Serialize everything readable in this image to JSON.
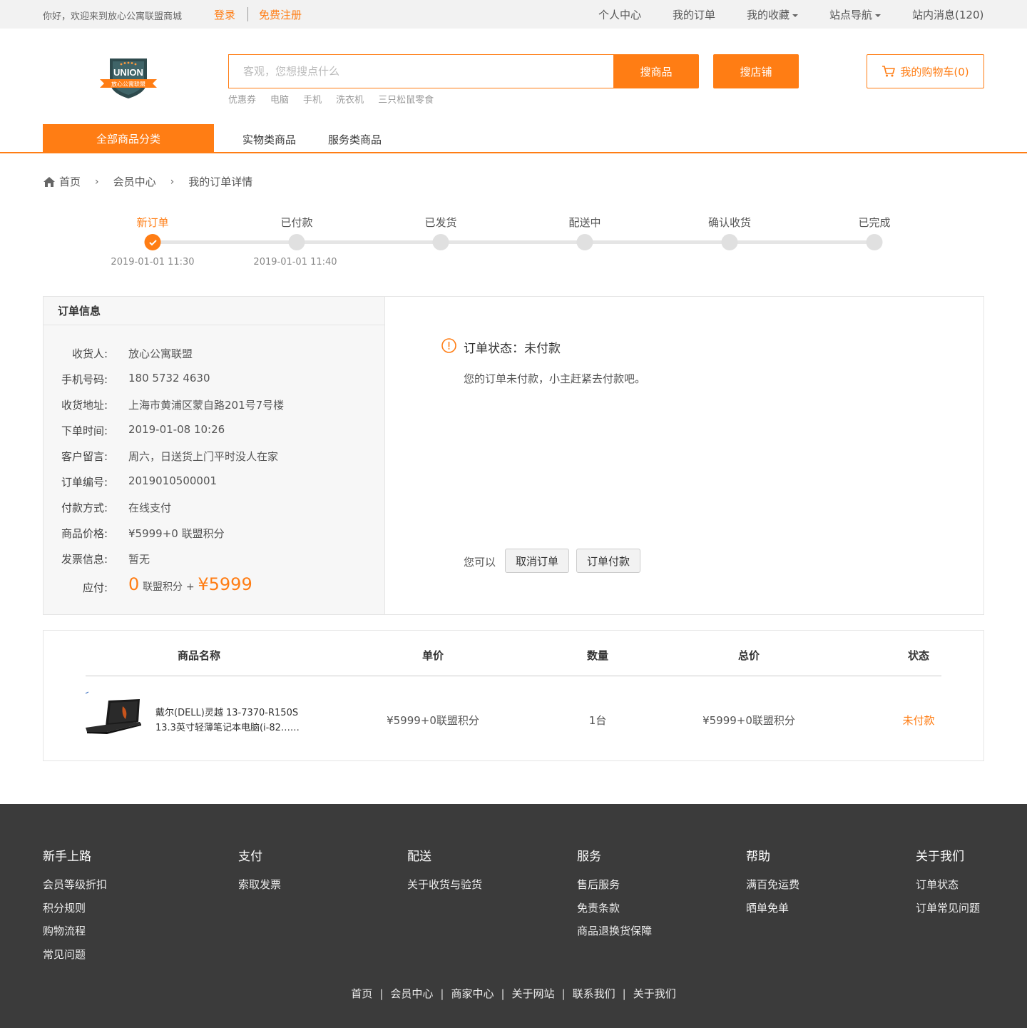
{
  "topbar": {
    "welcome": "你好，欢迎来到放心公寓联盟商城",
    "login": "登录",
    "register": "免费注册",
    "personal_center": "个人中心",
    "my_orders": "我的订单",
    "my_favorites": "我的收藏",
    "site_nav": "站点导航",
    "messages": "站内消息(120)"
  },
  "logo": {
    "text": "UNION",
    "subtext": "放心公寓联盟",
    "colors": {
      "shield": "#2e4a4d",
      "ribbon": "#ff7d14"
    }
  },
  "search": {
    "placeholder": "客观，您想搜点什么",
    "search_goods": "搜商品",
    "search_shops": "搜店铺",
    "hotwords": [
      "优惠券",
      "电脑",
      "手机",
      "洗衣机",
      "三只松鼠零食"
    ]
  },
  "cart": {
    "label": "我的购物车(0)"
  },
  "categories": {
    "all": "全部商品分类",
    "physical": "实物类商品",
    "service": "服务类商品"
  },
  "breadcrumb": {
    "home": "首页",
    "member": "会员中心",
    "current": "我的订单详情"
  },
  "progress": {
    "steps": [
      {
        "label": "新订单",
        "time": "2019-01-01  11:30",
        "active": true
      },
      {
        "label": "已付款",
        "time": "2019-01-01  11:40",
        "active": false
      },
      {
        "label": "已发货",
        "time": "",
        "active": false
      },
      {
        "label": "配送中",
        "time": "",
        "active": false
      },
      {
        "label": "确认收货",
        "time": "",
        "active": false
      },
      {
        "label": "已完成",
        "time": "",
        "active": false
      }
    ]
  },
  "order_info": {
    "title": "订单信息",
    "rows": [
      {
        "k": "收货人:",
        "v": "放心公寓联盟"
      },
      {
        "k": "手机号码:",
        "v": "180 5732 4630"
      },
      {
        "k": "收货地址:",
        "v": "上海市黄浦区蒙自路201号7号楼"
      },
      {
        "k": "下单时间:",
        "v": "2019-01-08 10:26"
      },
      {
        "k": "客户留言:",
        "v": "周六，日送货上门平时没人在家"
      },
      {
        "k": "订单编号:",
        "v": "2019010500001"
      },
      {
        "k": "付款方式:",
        "v": "在线支付"
      },
      {
        "k": "商品价格:",
        "v": "¥5999+0 联盟积分"
      },
      {
        "k": "发票信息:",
        "v": "暂无"
      }
    ],
    "payable_label": "应付:",
    "payable_points": "0",
    "payable_points_unit": "联盟积分",
    "payable_plus": "+",
    "payable_amount": "¥5999"
  },
  "status": {
    "title": "订单状态：未付款",
    "desc": "您的订单未付款，小主赶紧去付款吧。",
    "you_can": "您可以",
    "cancel": "取消订单",
    "pay": "订单付款"
  },
  "products": {
    "headers": {
      "name": "商品名称",
      "unit_price": "单价",
      "qty": "数量",
      "total": "总价",
      "status": "状态"
    },
    "rows": [
      {
        "name_line1": "戴尔(DELL)灵越 13-7370-R150S",
        "name_line2": "13.3英寸轻薄笔记本电脑(i-82……",
        "unit_price": "¥5999+0联盟积分",
        "qty": "1台",
        "total": "¥5999+0联盟积分",
        "status": "未付款"
      }
    ]
  },
  "footer": {
    "columns": [
      {
        "title": "新手上路",
        "items": [
          "会员等级折扣",
          "积分规则",
          "购物流程",
          "常见问题"
        ]
      },
      {
        "title": "支付",
        "items": [
          "索取发票"
        ]
      },
      {
        "title": "配送",
        "items": [
          "关于收货与验货"
        ]
      },
      {
        "title": "服务",
        "items": [
          "售后服务",
          "免责条款",
          "商品退换货保障"
        ]
      },
      {
        "title": "帮助",
        "items": [
          "满百免运费",
          "晒单免单"
        ]
      },
      {
        "title": "关于我们",
        "items": [
          "订单状态",
          "订单常见问题"
        ]
      }
    ],
    "links": [
      "首页",
      "会员中心",
      "商家中心",
      "关于网站",
      "联系我们",
      "关于我们"
    ]
  },
  "colors": {
    "accent": "#ff7d14",
    "footer_bg": "#3b3b3b",
    "topbar_bg": "#f2f2f2"
  }
}
